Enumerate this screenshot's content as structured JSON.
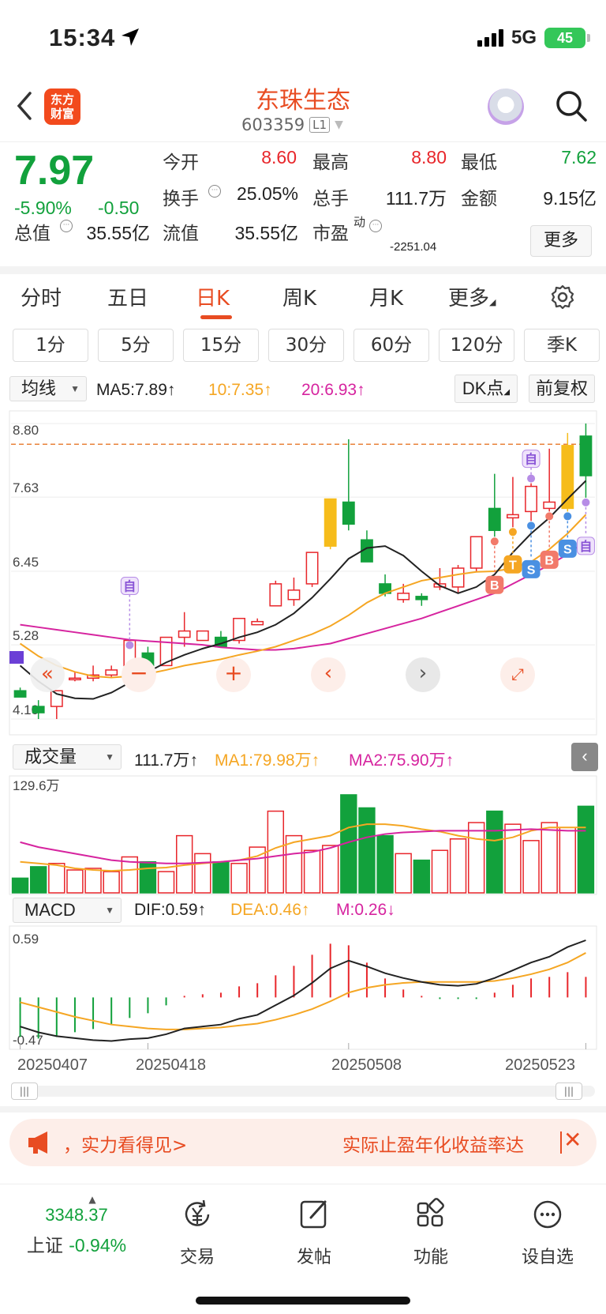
{
  "status": {
    "time": "15:34",
    "network": "5G",
    "battery": "45"
  },
  "header": {
    "logo_line1": "东方",
    "logo_line2": "财富",
    "stock_name": "东珠生态",
    "stock_code": "603359",
    "level_badge": "L1"
  },
  "quote": {
    "price": "7.97",
    "change_pct": "-5.90%",
    "change": "-0.50",
    "items": [
      {
        "label": "今开",
        "value": "8.60",
        "color": "red"
      },
      {
        "label": "最高",
        "value": "8.80",
        "color": "red"
      },
      {
        "label": "最低",
        "value": "7.62",
        "color": "green"
      },
      {
        "label": "换手",
        "value": "25.05%",
        "color": "dark"
      },
      {
        "label": "总手",
        "value": "111.7万",
        "color": "dark"
      },
      {
        "label": "金额",
        "value": "9.15亿",
        "color": "dark"
      },
      {
        "label": "总值",
        "value": "35.55亿",
        "color": "dark"
      },
      {
        "label": "流值",
        "value": "35.55亿",
        "color": "dark"
      },
      {
        "label": "市盈",
        "value": "-2251.04",
        "color": "dark"
      }
    ],
    "pe_superscript": "动",
    "more_label": "更多"
  },
  "period_tabs": [
    "分时",
    "五日",
    "日K",
    "周K",
    "月K",
    "更多"
  ],
  "active_period": "日K",
  "minute_buttons": [
    "1分",
    "5分",
    "15分",
    "30分",
    "60分",
    "120分",
    "季K"
  ],
  "ma_bar": {
    "selector": "均线",
    "ma5": "MA5:7.89",
    "ma10": "10:7.35",
    "ma20": "20:6.93",
    "dk_label": "DK点",
    "adjust_label": "前复权"
  },
  "volume_bar": {
    "selector": "成交量",
    "vol": "111.7万",
    "ma1": "MA1:79.98万",
    "ma2": "MA2:75.90万",
    "max_label": "129.6万"
  },
  "macd_bar": {
    "selector": "MACD",
    "dif": "DIF:0.59",
    "dea": "DEA:0.46",
    "m": "M:0.26",
    "top_label": "0.59",
    "bottom_label": "-0.47"
  },
  "colors": {
    "up": "#e8262b",
    "down": "#12a13c",
    "ma5": "#222222",
    "ma10": "#f5a623",
    "ma20": "#d6249f",
    "accent": "#e84c22"
  },
  "chart_data": {
    "type": "candlestick",
    "price_axis_labels": [
      "8.80",
      "7.63",
      "6.45",
      "5.28",
      "4.10"
    ],
    "date_labels": [
      "20250407",
      "20250418",
      "20250508",
      "20250523"
    ],
    "reference_price": 8.47,
    "candles": [
      {
        "o": 4.55,
        "h": 4.6,
        "l": 4.45,
        "c": 4.45
      },
      {
        "o": 4.3,
        "h": 4.4,
        "l": 4.1,
        "c": 4.2
      },
      {
        "o": 4.3,
        "h": 4.55,
        "l": 4.1,
        "c": 4.55
      },
      {
        "o": 4.75,
        "h": 4.85,
        "l": 4.7,
        "c": 4.75
      },
      {
        "o": 4.75,
        "h": 4.95,
        "l": 4.7,
        "c": 4.8
      },
      {
        "o": 4.8,
        "h": 4.95,
        "l": 4.75,
        "c": 4.88
      },
      {
        "o": 4.95,
        "h": 5.2,
        "l": 4.85,
        "c": 5.35
      },
      {
        "o": 5.15,
        "h": 5.25,
        "l": 4.95,
        "c": 4.95
      },
      {
        "o": 4.95,
        "h": 5.4,
        "l": 4.95,
        "c": 5.4
      },
      {
        "o": 5.4,
        "h": 5.8,
        "l": 5.25,
        "c": 5.5
      },
      {
        "o": 5.35,
        "h": 5.5,
        "l": 5.35,
        "c": 5.5
      },
      {
        "o": 5.4,
        "h": 5.5,
        "l": 5.25,
        "c": 5.25
      },
      {
        "o": 5.35,
        "h": 5.7,
        "l": 5.3,
        "c": 5.7
      },
      {
        "o": 5.6,
        "h": 5.7,
        "l": 5.6,
        "c": 5.65
      },
      {
        "o": 5.9,
        "h": 6.3,
        "l": 5.9,
        "c": 6.25
      },
      {
        "o": 6.0,
        "h": 6.35,
        "l": 5.9,
        "c": 6.15
      },
      {
        "o": 6.25,
        "h": 6.75,
        "l": 6.2,
        "c": 6.75
      },
      {
        "o": 6.85,
        "h": 7.6,
        "l": 6.8,
        "c": 7.6
      },
      {
        "o": 7.55,
        "h": 8.55,
        "l": 7.1,
        "c": 7.2
      },
      {
        "o": 6.95,
        "h": 7.1,
        "l": 6.6,
        "c": 6.6
      },
      {
        "o": 6.25,
        "h": 6.4,
        "l": 6.05,
        "c": 6.1
      },
      {
        "o": 6.0,
        "h": 6.25,
        "l": 5.95,
        "c": 6.1
      },
      {
        "o": 6.05,
        "h": 6.1,
        "l": 5.9,
        "c": 6.0
      },
      {
        "o": 6.2,
        "h": 6.5,
        "l": 6.15,
        "c": 6.25
      },
      {
        "o": 6.2,
        "h": 6.55,
        "l": 6.1,
        "c": 6.5
      },
      {
        "o": 6.5,
        "h": 7.0,
        "l": 6.45,
        "c": 7.0
      },
      {
        "o": 7.45,
        "h": 8.0,
        "l": 7.0,
        "c": 7.1
      },
      {
        "o": 7.3,
        "h": 7.95,
        "l": 7.15,
        "c": 7.35
      },
      {
        "o": 7.4,
        "h": 7.85,
        "l": 7.25,
        "c": 7.8
      },
      {
        "o": 7.45,
        "h": 8.4,
        "l": 7.4,
        "c": 7.55
      },
      {
        "o": 7.45,
        "h": 8.65,
        "l": 7.4,
        "c": 8.45
      },
      {
        "o": 8.6,
        "h": 8.8,
        "l": 7.62,
        "c": 7.97
      }
    ],
    "ma5": [
      4.95,
      4.7,
      4.5,
      4.43,
      4.42,
      4.52,
      4.68,
      4.85,
      5.0,
      5.12,
      5.22,
      5.3,
      5.4,
      5.48,
      5.6,
      5.78,
      6.03,
      6.33,
      6.65,
      6.82,
      6.85,
      6.7,
      6.45,
      6.22,
      6.1,
      6.2,
      6.4,
      6.75,
      7.05,
      7.3,
      7.6,
      7.89
    ],
    "ma10": [
      5.3,
      5.1,
      4.95,
      4.85,
      4.78,
      4.76,
      4.78,
      4.82,
      4.88,
      4.95,
      5.0,
      5.05,
      5.12,
      5.18,
      5.25,
      5.35,
      5.45,
      5.58,
      5.75,
      5.95,
      6.1,
      6.2,
      6.3,
      6.35,
      6.4,
      6.44,
      6.45,
      6.5,
      6.6,
      6.8,
      7.05,
      7.35
    ],
    "ma20": [
      5.6,
      5.56,
      5.52,
      5.48,
      5.44,
      5.4,
      5.36,
      5.34,
      5.32,
      5.3,
      5.28,
      5.24,
      5.22,
      5.2,
      5.2,
      5.22,
      5.26,
      5.3,
      5.38,
      5.46,
      5.54,
      5.62,
      5.7,
      5.8,
      5.9,
      6.0,
      6.1,
      6.25,
      6.4,
      6.55,
      6.72,
      6.93
    ],
    "volume": [
      18,
      32,
      36,
      28,
      30,
      26,
      44,
      38,
      26,
      70,
      48,
      38,
      36,
      56,
      100,
      70,
      52,
      58,
      120,
      104,
      70,
      48,
      40,
      52,
      66,
      86,
      100,
      84,
      64,
      86,
      80,
      106
    ],
    "volume_ma1": [
      38,
      36,
      34,
      30,
      28,
      27,
      28,
      30,
      31,
      34,
      36,
      38,
      40,
      45,
      55,
      62,
      66,
      70,
      80,
      84,
      84,
      82,
      78,
      75,
      70,
      66,
      64,
      68,
      76,
      80,
      80,
      80
    ],
    "volume_ma2": [
      62,
      56,
      52,
      48,
      44,
      40,
      38,
      37,
      36,
      36,
      37,
      38,
      40,
      42,
      45,
      48,
      50,
      55,
      62,
      68,
      72,
      74,
      75,
      76,
      76,
      76,
      76,
      77,
      78,
      77,
      76,
      76
    ],
    "macd_dif": [
      -0.3,
      -0.36,
      -0.4,
      -0.42,
      -0.44,
      -0.45,
      -0.43,
      -0.42,
      -0.38,
      -0.32,
      -0.3,
      -0.28,
      -0.22,
      -0.18,
      -0.08,
      0.02,
      0.15,
      0.3,
      0.38,
      0.32,
      0.25,
      0.2,
      0.16,
      0.13,
      0.12,
      0.14,
      0.2,
      0.28,
      0.36,
      0.42,
      0.52,
      0.59
    ],
    "macd_dea": [
      -0.05,
      -0.1,
      -0.15,
      -0.2,
      -0.24,
      -0.28,
      -0.3,
      -0.32,
      -0.33,
      -0.33,
      -0.32,
      -0.31,
      -0.29,
      -0.27,
      -0.23,
      -0.18,
      -0.12,
      -0.04,
      0.05,
      0.1,
      0.13,
      0.15,
      0.16,
      0.16,
      0.16,
      0.16,
      0.17,
      0.2,
      0.24,
      0.29,
      0.36,
      0.46
    ],
    "macd_m": [
      -0.5,
      -0.52,
      -0.5,
      -0.44,
      -0.4,
      -0.34,
      -0.26,
      -0.2,
      -0.1,
      0.02,
      0.04,
      0.06,
      0.14,
      0.18,
      0.28,
      0.4,
      0.54,
      0.68,
      0.66,
      0.44,
      0.24,
      0.1,
      0.02,
      -0.02,
      -0.02,
      -0.02,
      0.06,
      0.16,
      0.24,
      0.26,
      0.32,
      0.26
    ],
    "signals": [
      {
        "index": 6,
        "label": "自",
        "pos": "top"
      },
      {
        "index": 26,
        "label": "B",
        "pos": "bottom"
      },
      {
        "index": 27,
        "label": "T",
        "pos": "bottom"
      },
      {
        "index": 28,
        "label": "S",
        "pos": "bottom"
      },
      {
        "index": 28,
        "label": "自",
        "pos": "top"
      },
      {
        "index": 29,
        "label": "B",
        "pos": "bottom"
      },
      {
        "index": 30,
        "label": "S",
        "pos": "bottom"
      },
      {
        "index": 31,
        "label": "自",
        "pos": "bottom"
      }
    ]
  },
  "banner": {
    "text1": "，实力看得见>",
    "text2": "实际止盈年化收益率达"
  },
  "bottom_nav": {
    "index_value": "3348.37",
    "index_name": "上证",
    "index_change": "-0.94%",
    "items": [
      "交易",
      "发帖",
      "功能",
      "设自选"
    ]
  }
}
